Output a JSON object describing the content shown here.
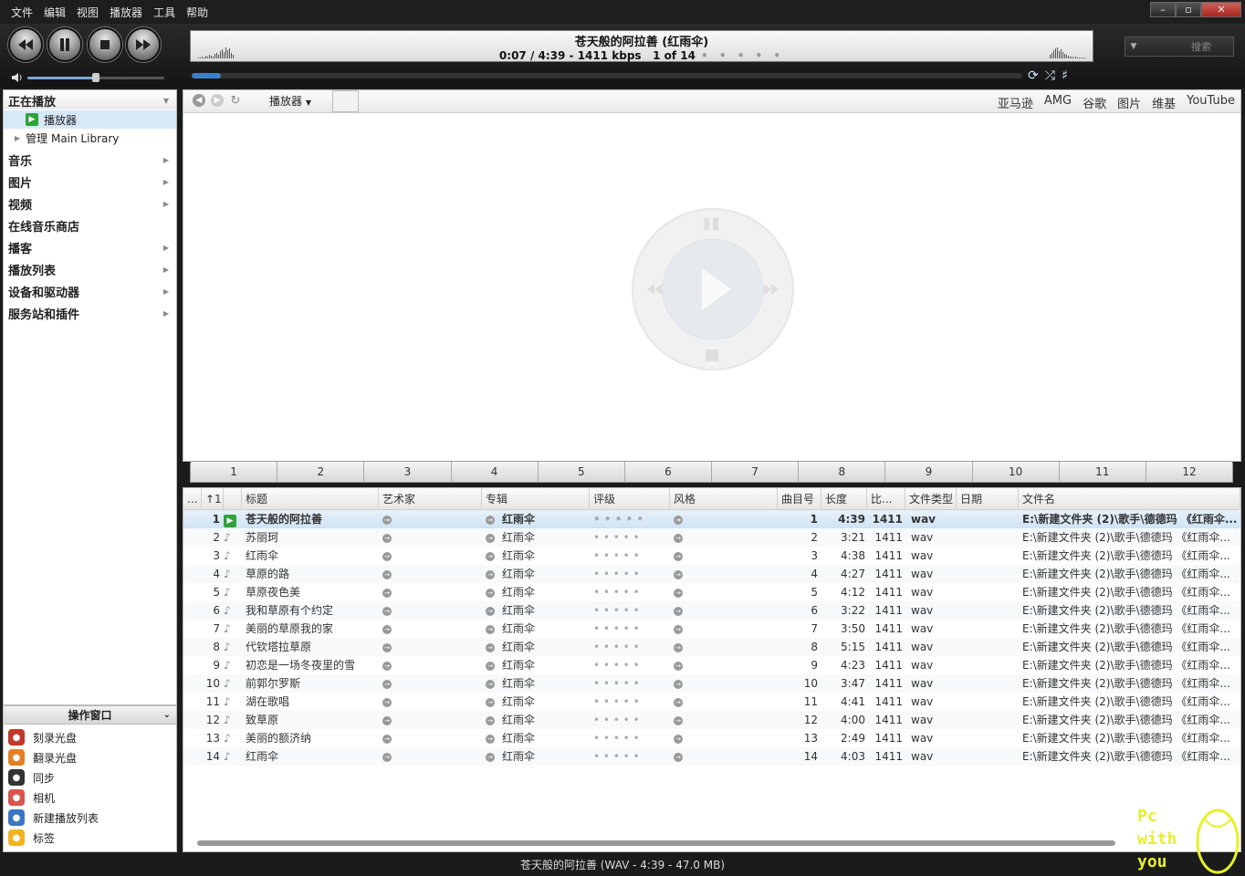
{
  "menu": [
    "文件",
    "编辑",
    "视图",
    "播放器",
    "工具",
    "帮助"
  ],
  "window_buttons": [
    "–",
    "▫",
    "✕"
  ],
  "now_playing": {
    "title": "苍天般的阿拉善 (红雨伞)",
    "time": "0:07 / 4:39 - 1411 kbps",
    "position": "1 of 14",
    "dots": "• • • • •",
    "progress": 0.025
  },
  "volume": 0.5,
  "search": {
    "placeholder": "搜索",
    "dropdown": "▼"
  },
  "sidebar": {
    "header": "正在播放",
    "player": "播放器",
    "library": "管理 Main Library",
    "items": [
      "音乐",
      "图片",
      "视频",
      "在线音乐商店",
      "播客",
      "播放列表",
      "设备和驱动器",
      "服务站和插件"
    ]
  },
  "actions": {
    "header": "操作窗口",
    "items": [
      {
        "label": "刻录光盘",
        "icon": "burn-disc-icon",
        "color": "#c0392b"
      },
      {
        "label": "翻录光盘",
        "icon": "rip-disc-icon",
        "color": "#e67e22"
      },
      {
        "label": "同步",
        "icon": "sync-icon",
        "color": "#333333"
      },
      {
        "label": "相机",
        "icon": "camera-icon",
        "color": "#d9534f"
      },
      {
        "label": "新建播放列表",
        "icon": "new-playlist-icon",
        "color": "#3a76c4"
      },
      {
        "label": "标签",
        "icon": "tag-icon",
        "color": "#f0b323"
      }
    ]
  },
  "view": {
    "tab": "播放器",
    "links": [
      "亚马逊",
      "AMG",
      "谷歌",
      "图片",
      "维基",
      "YouTube"
    ]
  },
  "number_bar": [
    "1",
    "2",
    "3",
    "4",
    "5",
    "6",
    "7",
    "8",
    "9",
    "10",
    "11",
    "12"
  ],
  "columns": [
    "...",
    "↑1",
    "",
    "标题",
    "艺术家",
    "专辑",
    "评级",
    "风格",
    "曲目号",
    "长度",
    "比...",
    "文件类型",
    "日期",
    "文件名"
  ],
  "tracks": [
    {
      "n": "1",
      "title": "苍天般的阿拉善",
      "album": "红雨伞",
      "track": "1",
      "length": "4:39",
      "bitrate": "1411",
      "type": "wav",
      "file": "E:\\新建文件夹 (2)\\歌手\\德德玛 《红雨伞..."
    },
    {
      "n": "2",
      "title": "苏丽珂",
      "album": "红雨伞",
      "track": "2",
      "length": "3:21",
      "bitrate": "1411",
      "type": "wav",
      "file": "E:\\新建文件夹 (2)\\歌手\\德德玛 《红雨伞..."
    },
    {
      "n": "3",
      "title": "红雨伞",
      "album": "红雨伞",
      "track": "3",
      "length": "4:38",
      "bitrate": "1411",
      "type": "wav",
      "file": "E:\\新建文件夹 (2)\\歌手\\德德玛 《红雨伞..."
    },
    {
      "n": "4",
      "title": "草原的路",
      "album": "红雨伞",
      "track": "4",
      "length": "4:27",
      "bitrate": "1411",
      "type": "wav",
      "file": "E:\\新建文件夹 (2)\\歌手\\德德玛 《红雨伞..."
    },
    {
      "n": "5",
      "title": "草原夜色美",
      "album": "红雨伞",
      "track": "5",
      "length": "4:12",
      "bitrate": "1411",
      "type": "wav",
      "file": "E:\\新建文件夹 (2)\\歌手\\德德玛 《红雨伞..."
    },
    {
      "n": "6",
      "title": "我和草原有个约定",
      "album": "红雨伞",
      "track": "6",
      "length": "3:22",
      "bitrate": "1411",
      "type": "wav",
      "file": "E:\\新建文件夹 (2)\\歌手\\德德玛 《红雨伞..."
    },
    {
      "n": "7",
      "title": "美丽的草原我的家",
      "album": "红雨伞",
      "track": "7",
      "length": "3:50",
      "bitrate": "1411",
      "type": "wav",
      "file": "E:\\新建文件夹 (2)\\歌手\\德德玛 《红雨伞..."
    },
    {
      "n": "8",
      "title": "代钦塔拉草原",
      "album": "红雨伞",
      "track": "8",
      "length": "5:15",
      "bitrate": "1411",
      "type": "wav",
      "file": "E:\\新建文件夹 (2)\\歌手\\德德玛 《红雨伞..."
    },
    {
      "n": "9",
      "title": "初恋是一场冬夜里的雪",
      "album": "红雨伞",
      "track": "9",
      "length": "4:23",
      "bitrate": "1411",
      "type": "wav",
      "file": "E:\\新建文件夹 (2)\\歌手\\德德玛 《红雨伞..."
    },
    {
      "n": "10",
      "title": "前郭尔罗斯",
      "album": "红雨伞",
      "track": "10",
      "length": "3:47",
      "bitrate": "1411",
      "type": "wav",
      "file": "E:\\新建文件夹 (2)\\歌手\\德德玛 《红雨伞..."
    },
    {
      "n": "11",
      "title": "湖在歌唱",
      "album": "红雨伞",
      "track": "11",
      "length": "4:41",
      "bitrate": "1411",
      "type": "wav",
      "file": "E:\\新建文件夹 (2)\\歌手\\德德玛 《红雨伞..."
    },
    {
      "n": "12",
      "title": "致草原",
      "album": "红雨伞",
      "track": "12",
      "length": "4:00",
      "bitrate": "1411",
      "type": "wav",
      "file": "E:\\新建文件夹 (2)\\歌手\\德德玛 《红雨伞..."
    },
    {
      "n": "13",
      "title": "美丽的额济纳",
      "album": "红雨伞",
      "track": "13",
      "length": "2:49",
      "bitrate": "1411",
      "type": "wav",
      "file": "E:\\新建文件夹 (2)\\歌手\\德德玛 《红雨伞..."
    },
    {
      "n": "14",
      "title": "红雨伞",
      "album": "红雨伞",
      "track": "14",
      "length": "4:03",
      "bitrate": "1411",
      "type": "wav",
      "file": "E:\\新建文件夹 (2)\\歌手\\德德玛 《红雨伞..."
    }
  ],
  "rating_dots": "•  •  •  •  •",
  "status": "苍天般的阿拉善 (WAV - 4:39 - 47.0 MB)",
  "watermark": [
    "Pc",
    "with",
    "you"
  ]
}
